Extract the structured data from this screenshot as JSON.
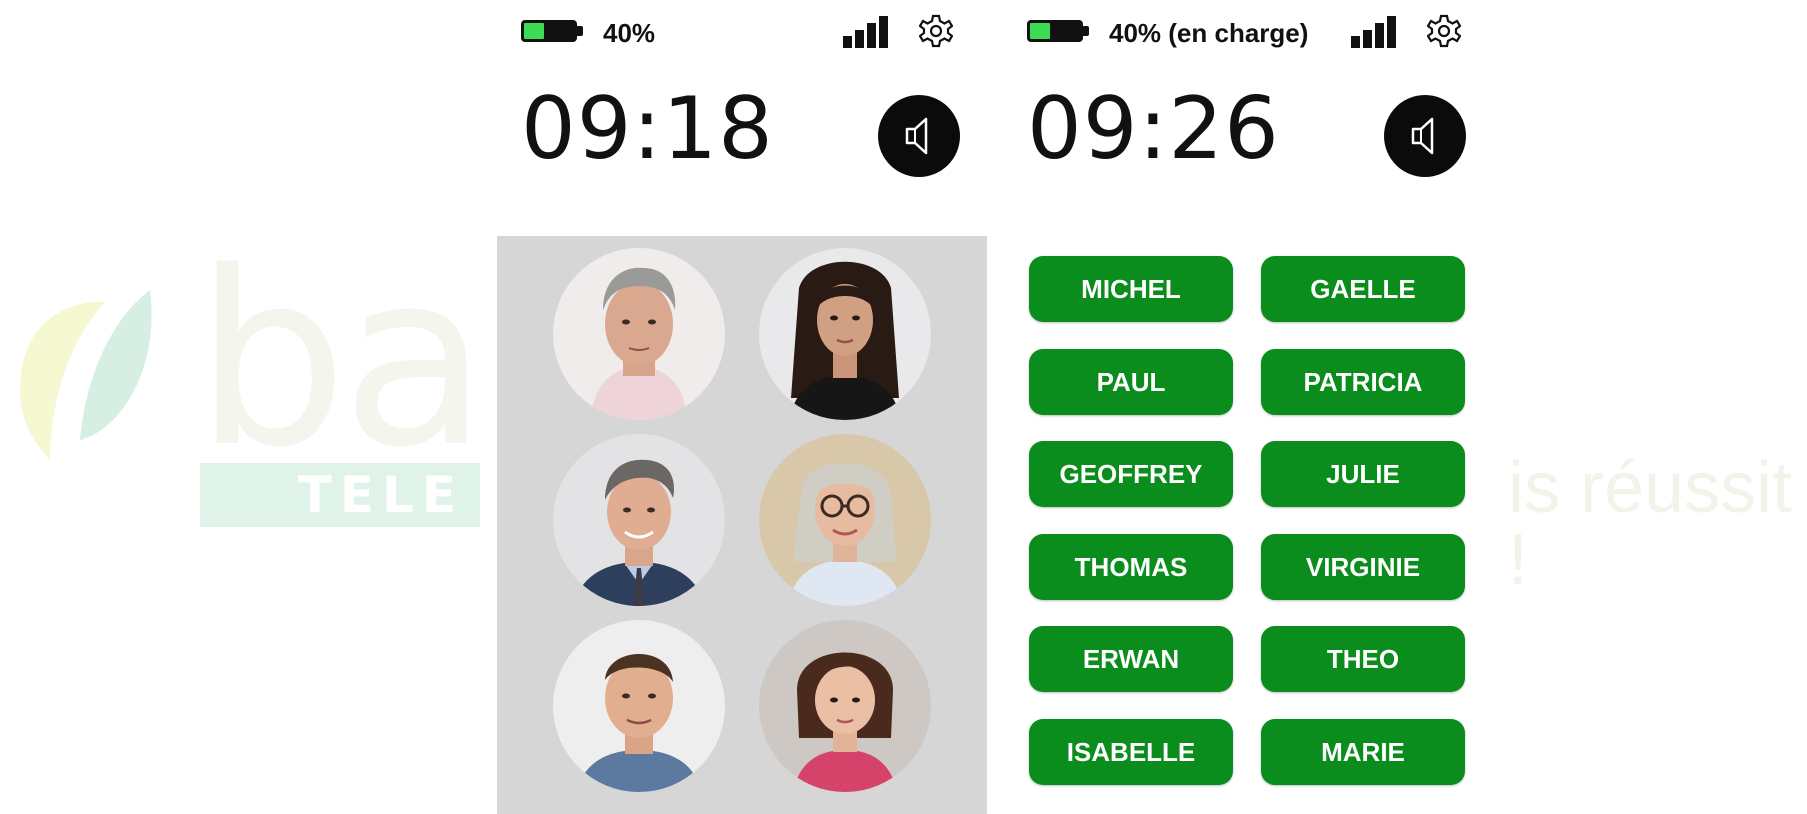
{
  "watermark": {
    "brand": "ba",
    "band": "TELE",
    "slogan": "is réussit !"
  },
  "phone_left": {
    "battery_text": "40%",
    "battery_level": 0.4,
    "clock": "09:18",
    "contacts": [
      {
        "name": "man-grey-hair-photo"
      },
      {
        "name": "woman-dark-hair-photo"
      },
      {
        "name": "man-smiling-tie-photo"
      },
      {
        "name": "woman-glasses-photo"
      },
      {
        "name": "young-man-photo"
      },
      {
        "name": "woman-bob-hair-photo"
      }
    ]
  },
  "phone_right": {
    "battery_text": "40% (en charge)",
    "battery_level": 0.4,
    "clock": "09:26",
    "contacts": [
      "MICHEL",
      "GAELLE",
      "PAUL",
      "PATRICIA",
      "GEOFFREY",
      "JULIE",
      "THOMAS",
      "VIRGINIE",
      "ERWAN",
      "THEO",
      "ISABELLE",
      "MARIE"
    ]
  },
  "colors": {
    "button_green": "#0a8d1c",
    "battery_green": "#3cdd55",
    "panel_grey": "#d6d6d6"
  },
  "icons": {
    "signal": "signal-bars-icon",
    "settings": "gear-icon",
    "speaker": "speaker-icon",
    "battery": "battery-icon"
  }
}
